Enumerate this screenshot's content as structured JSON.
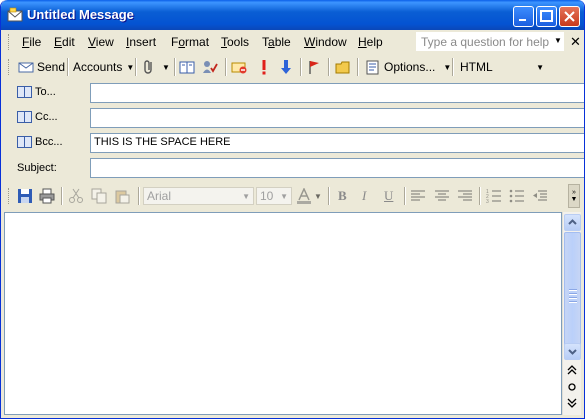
{
  "window": {
    "title": "Untitled Message",
    "minimize": "_",
    "maximize": "□",
    "close": "✕"
  },
  "menu": {
    "items": [
      {
        "label": "File",
        "u": "F",
        "rest": "ile"
      },
      {
        "label": "Edit",
        "u": "E",
        "rest": "dit"
      },
      {
        "label": "View",
        "u": "V",
        "rest": "iew"
      },
      {
        "label": "Insert",
        "u": "I",
        "rest": "nsert"
      },
      {
        "label": "Format",
        "u": "o",
        "pre": "F",
        "rest": "rmat"
      },
      {
        "label": "Tools",
        "u": "T",
        "rest": "ools"
      },
      {
        "label": "Table",
        "u": "a",
        "pre": "T",
        "rest": "ble"
      },
      {
        "label": "Window",
        "u": "W",
        "rest": "indow"
      },
      {
        "label": "Help",
        "u": "H",
        "rest": "elp"
      }
    ],
    "help_placeholder": "Type a question for help",
    "close_symbol": "✕"
  },
  "toolbar": {
    "send_label": "Send",
    "accounts_label": "Accounts",
    "options_label": "Options...",
    "format_select": "HTML"
  },
  "fields": {
    "to_label": "To...",
    "cc_label": "Cc...",
    "bcc_label": "Bcc...",
    "subject_label": "Subject:",
    "to_value": "",
    "cc_value": "",
    "bcc_value": "THIS IS THE SPACE HERE",
    "subject_value": ""
  },
  "format_toolbar": {
    "font_name": "Arial",
    "font_size": "10",
    "bold": "B",
    "italic": "I",
    "underline": "U"
  },
  "colors": {
    "title_bar": "#0a5ed4",
    "chrome": "#ece9d8",
    "input_border": "#7f9db9"
  }
}
